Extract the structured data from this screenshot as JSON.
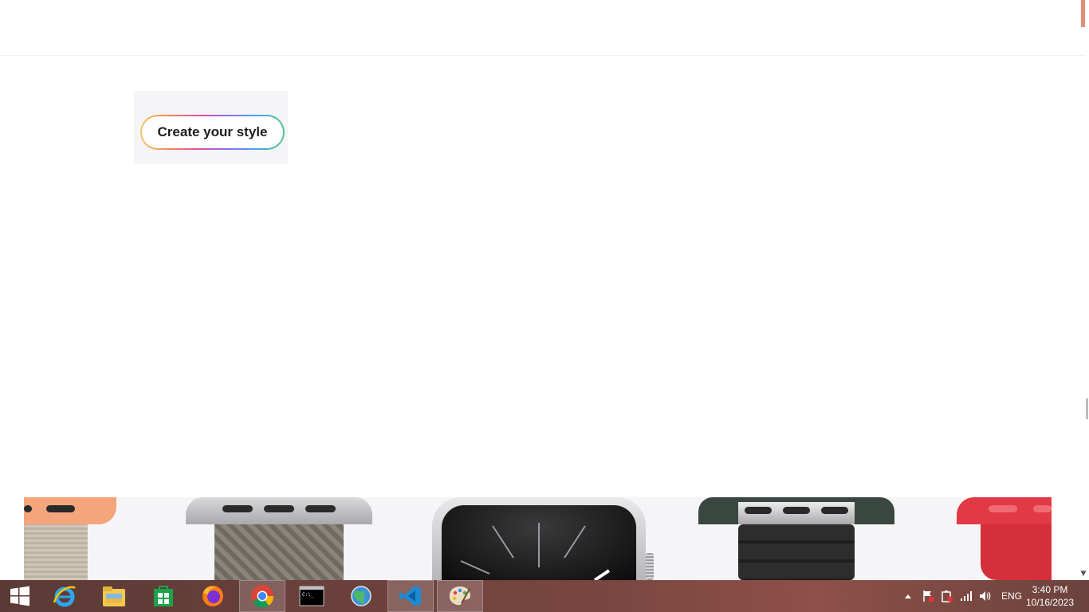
{
  "page": {
    "cta_label": "Create your style"
  },
  "bands": [
    {
      "name": "woven-band-orange",
      "color": "#f4a57c"
    },
    {
      "name": "braided-loop-gray",
      "color": "#7b776d"
    },
    {
      "name": "watch-case-stainless",
      "color": "#1c1c1e"
    },
    {
      "name": "leather-link-green",
      "color": "#3a4640"
    },
    {
      "name": "sport-band-red",
      "color": "#e23a45"
    }
  ],
  "taskbar": {
    "apps": [
      {
        "name": "start-button",
        "icon": "windows-logo-icon"
      },
      {
        "name": "internet-explorer",
        "icon": "internet-explorer-icon"
      },
      {
        "name": "file-explorer",
        "icon": "folder-icon"
      },
      {
        "name": "store",
        "icon": "store-icon"
      },
      {
        "name": "firefox",
        "icon": "firefox-icon"
      },
      {
        "name": "chrome",
        "icon": "chrome-icon",
        "active": true
      },
      {
        "name": "command-prompt",
        "icon": "terminal-icon"
      },
      {
        "name": "network-app",
        "icon": "globe-icon"
      },
      {
        "name": "vscode",
        "icon": "vscode-icon"
      },
      {
        "name": "paint",
        "icon": "palette-icon"
      }
    ],
    "tray": {
      "language": "ENG",
      "time": "3:40 PM",
      "date": "10/16/2023"
    }
  }
}
